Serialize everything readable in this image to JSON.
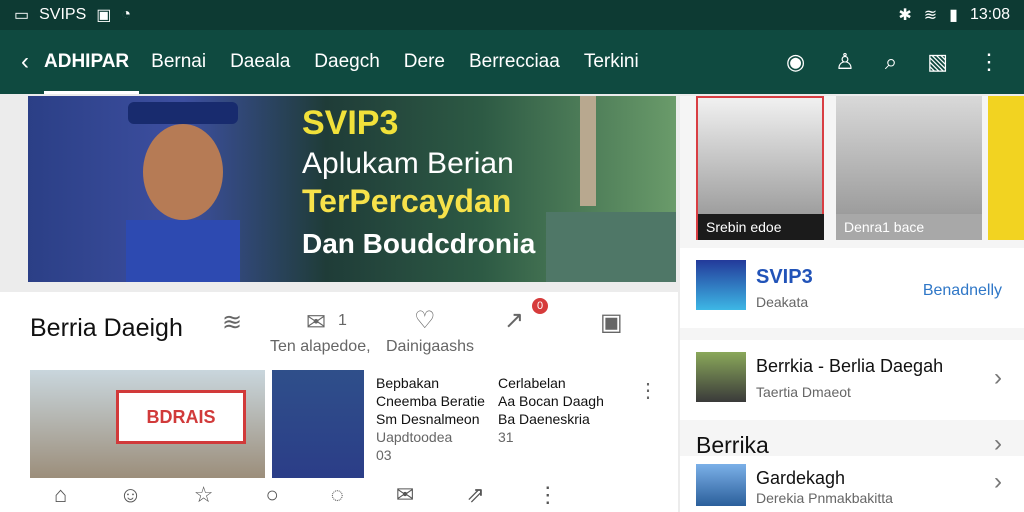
{
  "status": {
    "left": "SVIPS",
    "right": "13:08"
  },
  "appbar": {
    "brand": "ADHIPAR",
    "tabs": [
      "Bernai",
      "Daeala",
      "Daegch",
      "Dere",
      "Berrecciaa",
      "Terkini"
    ]
  },
  "hero": {
    "line1": "SVIP3",
    "line2": "Aplukam Berian",
    "line3": "TerPercaydan",
    "line4": "Dan Boudcdronia"
  },
  "section": {
    "title": "Berria Daeigh",
    "stat1": "Ten alapedoe,",
    "stat2": "Dainigaashs",
    "badge": "1",
    "notif": "0"
  },
  "cards": [
    {
      "title": "Bepbakan",
      "line1": "Cneemba Beratie",
      "line2": "Sm Desnalmeon",
      "line3": "Uapdtoodea",
      "line4": "03"
    },
    {
      "title": "Cerlabelan",
      "line1": "Aa Bocan Daagh",
      "line2": "Ba Daeneskria",
      "line3": "31"
    }
  ],
  "right": {
    "cap1": "Srebin edoe",
    "cap2": "Denra1 bace",
    "channel": {
      "title": "SVIP3",
      "sub": "Deakata",
      "follow": "Benadnelly"
    },
    "item1": {
      "title": "Berrkia - Berlia Daegah",
      "sub": "Taertia Dmaeot"
    },
    "section2": "Berrika",
    "item2": {
      "title": "Gardekagh",
      "sub": "Derekia Pnmakbakitta"
    }
  }
}
